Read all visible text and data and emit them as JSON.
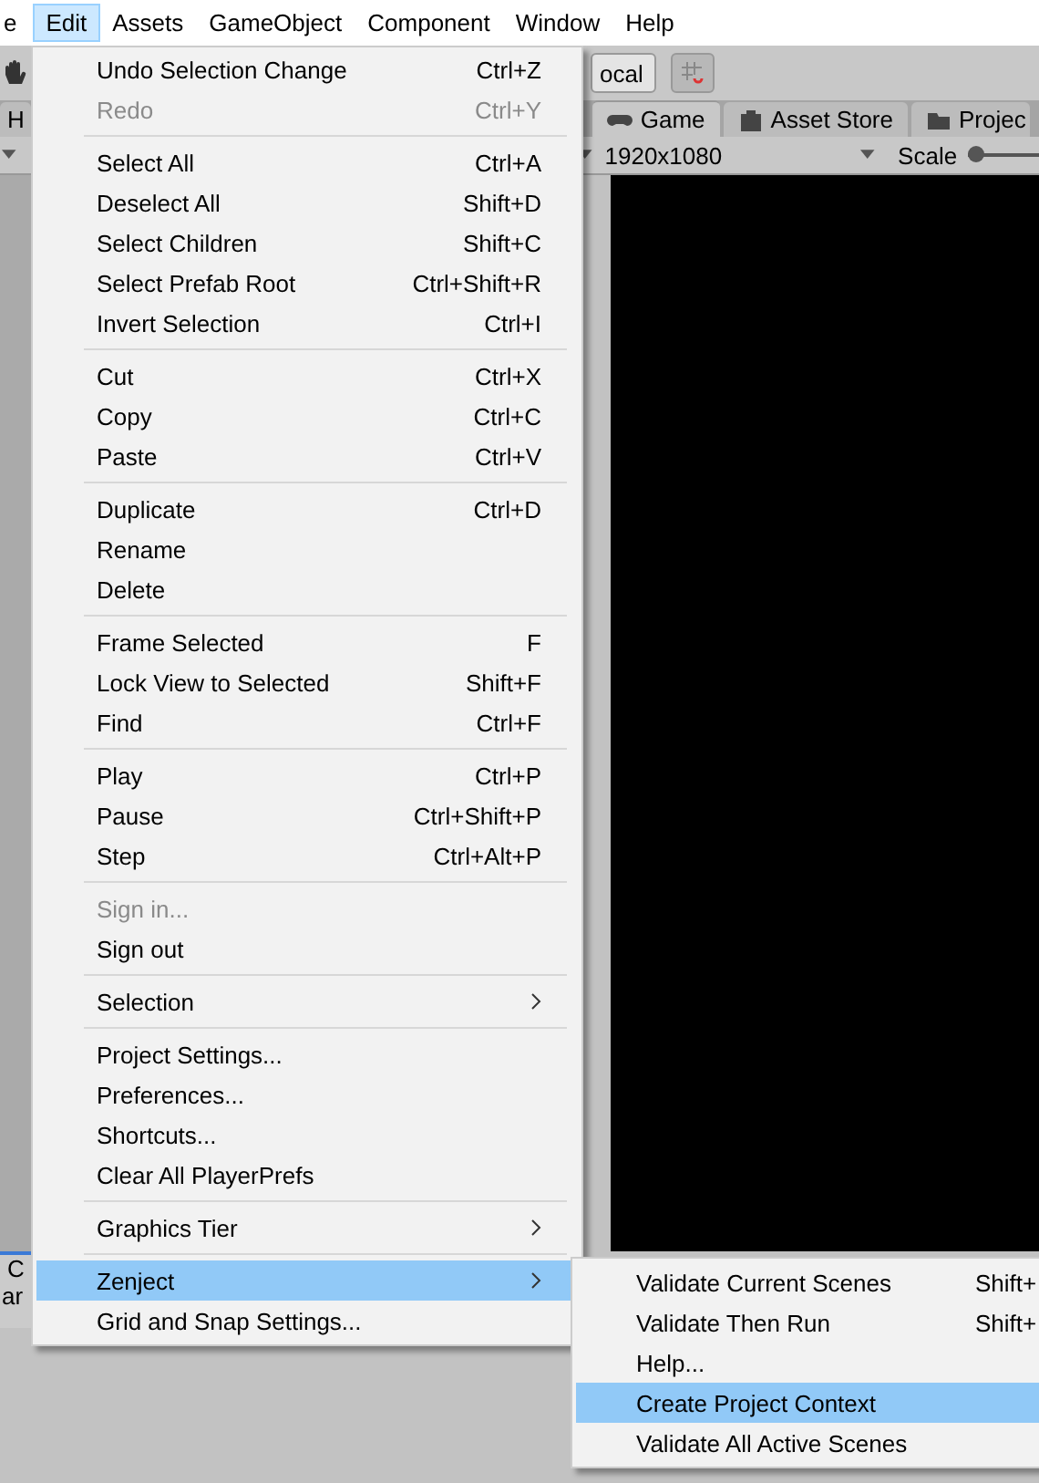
{
  "menu_bar": [
    {
      "label": "e",
      "selected": false
    },
    {
      "label": "Edit",
      "selected": true
    },
    {
      "label": "Assets",
      "selected": false
    },
    {
      "label": "GameObject",
      "selected": false
    },
    {
      "label": "Component",
      "selected": false
    },
    {
      "label": "Window",
      "selected": false
    },
    {
      "label": "Help",
      "selected": false
    }
  ],
  "toolbar": {
    "pivot_label": "ocal"
  },
  "tabs": [
    {
      "label": "H",
      "selected": false
    },
    {
      "label": "Game",
      "selected": true
    },
    {
      "label": "Asset Store",
      "selected": false
    },
    {
      "label": "Projec",
      "selected": false
    }
  ],
  "game_view": {
    "resolution": "1920x1080",
    "scale_label": "Scale",
    "scale_slider": {
      "level": 0
    }
  },
  "bottom_panel": {
    "tab": "C",
    "text": "ar"
  },
  "edit_menu": [
    {
      "kind": "item",
      "label": "Undo Selection Change",
      "shortcut": "Ctrl+Z",
      "disabled": false,
      "submenu": false,
      "selected": false
    },
    {
      "kind": "item",
      "label": "Redo",
      "shortcut": "Ctrl+Y",
      "disabled": true,
      "submenu": false,
      "selected": false
    },
    {
      "kind": "separator"
    },
    {
      "kind": "item",
      "label": "Select All",
      "shortcut": "Ctrl+A",
      "disabled": false,
      "submenu": false,
      "selected": false
    },
    {
      "kind": "item",
      "label": "Deselect All",
      "shortcut": "Shift+D",
      "disabled": false,
      "submenu": false,
      "selected": false
    },
    {
      "kind": "item",
      "label": "Select Children",
      "shortcut": "Shift+C",
      "disabled": false,
      "submenu": false,
      "selected": false
    },
    {
      "kind": "item",
      "label": "Select Prefab Root",
      "shortcut": "Ctrl+Shift+R",
      "disabled": false,
      "submenu": false,
      "selected": false
    },
    {
      "kind": "item",
      "label": "Invert Selection",
      "shortcut": "Ctrl+I",
      "disabled": false,
      "submenu": false,
      "selected": false
    },
    {
      "kind": "separator"
    },
    {
      "kind": "item",
      "label": "Cut",
      "shortcut": "Ctrl+X",
      "disabled": false,
      "submenu": false,
      "selected": false
    },
    {
      "kind": "item",
      "label": "Copy",
      "shortcut": "Ctrl+C",
      "disabled": false,
      "submenu": false,
      "selected": false
    },
    {
      "kind": "item",
      "label": "Paste",
      "shortcut": "Ctrl+V",
      "disabled": false,
      "submenu": false,
      "selected": false
    },
    {
      "kind": "separator"
    },
    {
      "kind": "item",
      "label": "Duplicate",
      "shortcut": "Ctrl+D",
      "disabled": false,
      "submenu": false,
      "selected": false
    },
    {
      "kind": "item",
      "label": "Rename",
      "disabled": false,
      "submenu": false,
      "selected": false
    },
    {
      "kind": "item",
      "label": "Delete",
      "disabled": false,
      "submenu": false,
      "selected": false
    },
    {
      "kind": "separator"
    },
    {
      "kind": "item",
      "label": "Frame Selected",
      "shortcut": "F",
      "disabled": false,
      "submenu": false,
      "selected": false
    },
    {
      "kind": "item",
      "label": "Lock View to Selected",
      "shortcut": "Shift+F",
      "disabled": false,
      "submenu": false,
      "selected": false
    },
    {
      "kind": "item",
      "label": "Find",
      "shortcut": "Ctrl+F",
      "disabled": false,
      "submenu": false,
      "selected": false
    },
    {
      "kind": "separator"
    },
    {
      "kind": "item",
      "label": "Play",
      "shortcut": "Ctrl+P",
      "disabled": false,
      "submenu": false,
      "selected": false
    },
    {
      "kind": "item",
      "label": "Pause",
      "shortcut": "Ctrl+Shift+P",
      "disabled": false,
      "submenu": false,
      "selected": false
    },
    {
      "kind": "item",
      "label": "Step",
      "shortcut": "Ctrl+Alt+P",
      "disabled": false,
      "submenu": false,
      "selected": false
    },
    {
      "kind": "separator"
    },
    {
      "kind": "item",
      "label": "Sign in...",
      "disabled": true,
      "submenu": false,
      "selected": false
    },
    {
      "kind": "item",
      "label": "Sign out",
      "disabled": false,
      "submenu": false,
      "selected": false
    },
    {
      "kind": "separator"
    },
    {
      "kind": "item",
      "label": "Selection",
      "disabled": false,
      "submenu": true,
      "selected": false
    },
    {
      "kind": "separator"
    },
    {
      "kind": "item",
      "label": "Project Settings...",
      "disabled": false,
      "submenu": false,
      "selected": false
    },
    {
      "kind": "item",
      "label": "Preferences...",
      "disabled": false,
      "submenu": false,
      "selected": false
    },
    {
      "kind": "item",
      "label": "Shortcuts...",
      "disabled": false,
      "submenu": false,
      "selected": false
    },
    {
      "kind": "item",
      "label": "Clear All PlayerPrefs",
      "disabled": false,
      "submenu": false,
      "selected": false
    },
    {
      "kind": "separator"
    },
    {
      "kind": "item",
      "label": "Graphics Tier",
      "disabled": false,
      "submenu": true,
      "selected": false
    },
    {
      "kind": "separator"
    },
    {
      "kind": "item",
      "label": "Zenject",
      "disabled": false,
      "submenu": true,
      "selected": true
    },
    {
      "kind": "item",
      "label": "Grid and Snap Settings...",
      "disabled": false,
      "submenu": false,
      "selected": false
    }
  ],
  "zenject_menu": [
    {
      "label": "Validate Current Scenes",
      "shortcut": "Shift+",
      "selected": false
    },
    {
      "label": "Validate Then Run",
      "shortcut": "Shift+",
      "selected": false
    },
    {
      "label": "Help...",
      "selected": false
    },
    {
      "label": "Create Project Context",
      "selected": true
    },
    {
      "label": "Validate All Active Scenes",
      "selected": false
    }
  ]
}
